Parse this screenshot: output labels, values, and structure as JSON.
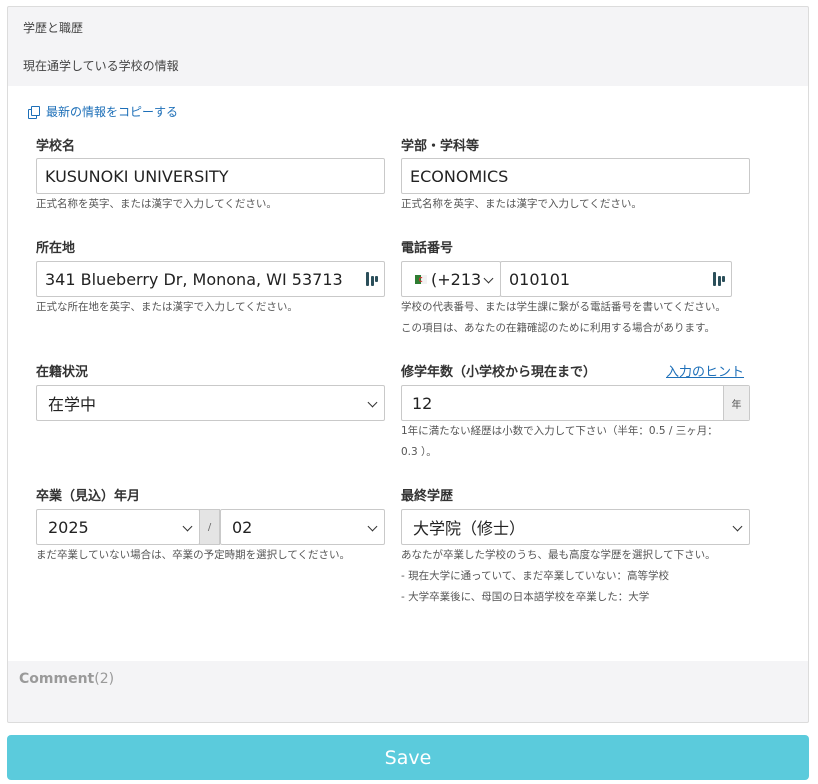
{
  "section": {
    "title": "学歴と職歴",
    "subtitle": "現在通学している学校の情報"
  },
  "copy_link": "最新の情報をコピーする",
  "school_name": {
    "label": "学校名",
    "value": "KUSUNOKI UNIVERSITY",
    "help": "正式名称を英字、または漢字で入力してください。"
  },
  "department": {
    "label": "学部・学科等",
    "value": "ECONOMICS",
    "help": "正式名称を英字、または漢字で入力してください。"
  },
  "address": {
    "label": "所在地",
    "value": "341 Blueberry Dr, Monona, WI 53713",
    "help": "正式な所在地を英字、または漢字で入力してください。"
  },
  "phone": {
    "label": "電話番号",
    "country_code": "(+213",
    "number": "010101",
    "help_line1": "学校の代表番号、または学生課に繋がる電話番号を書いてください。",
    "help_line2": "この項目は、あなたの在籍確認のために利用する場合があります。"
  },
  "enrollment": {
    "label": "在籍状況",
    "value": "在学中"
  },
  "years_of_study": {
    "label": "修学年数（小学校から現在まで）",
    "hint_link": "入力のヒント",
    "value": "12",
    "unit": "年",
    "help_line1": "1年に満たない経歴は小数で入力して下さい（半年：0.5 / 三ヶ月：",
    "help_line2": "0.3 ）。"
  },
  "graduation": {
    "label": "卒業（見込）年月",
    "year": "2025",
    "separator": "/",
    "month": "02",
    "help": "まだ卒業していない場合は、卒業の予定時期を選択してください。"
  },
  "final_education": {
    "label": "最終学歴",
    "value": "大学院（修士）",
    "help_line1": "あなたが卒業した学校のうち、最も高度な学歴を選択して下さい。",
    "help_line2": "- 現在大学に通っていて、まだ卒業していない：高等学校",
    "help_line3": "- 大学卒業後に、母国の日本語学校を卒業した：大学"
  },
  "comment": {
    "label": "Comment",
    "count": "(2)"
  },
  "save_button": "Save",
  "colors": {
    "accent": "#5bcbdc",
    "link": "#1d6fb8"
  }
}
